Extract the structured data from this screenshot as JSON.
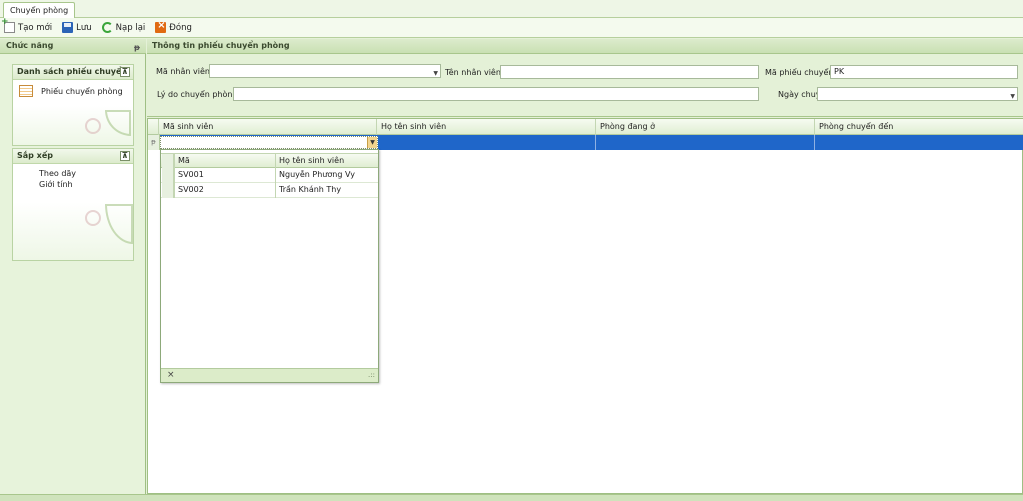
{
  "tab": {
    "label": "Chuyển phòng"
  },
  "toolbar": {
    "new_label": "Tạo mới",
    "save_label": "Lưu",
    "reload_label": "Nạp lại",
    "close_label": "Đóng"
  },
  "left_panel": {
    "title": "Chức năng",
    "pin": "ᵽ",
    "group1": {
      "title": "Danh sách phiếu chuyển",
      "toggle": "⊼",
      "items": [
        "Phiếu chuyển phòng"
      ]
    },
    "group2": {
      "title": "Sắp xếp",
      "toggle": "⊼",
      "items": [
        "Theo dãy",
        "Giới tính"
      ]
    }
  },
  "info_panel": {
    "title": "Thông tin phiếu chuyển phòng",
    "ma_nhan_vien_label": "Mã nhân viên:",
    "ma_nhan_vien_value": "",
    "ten_nhan_vien_label": "Tên nhân viên:",
    "ten_nhan_vien_value": "",
    "ma_phieu_label": "Mã phiếu chuyển:",
    "ma_phieu_value": "PK",
    "ly_do_label": "Lý do chuyển phòng:",
    "ly_do_value": "",
    "ngay_label": "Ngày chuyển:",
    "ngay_value": ""
  },
  "grid": {
    "columns": [
      "Mã sinh viên",
      "Họ tên sinh viên",
      "Phòng đang ở",
      "Phòng chuyển đến"
    ],
    "row_indicator": "ᵽ"
  },
  "popup": {
    "columns": [
      "Mã",
      "Họ tên sinh viên"
    ],
    "rows": [
      {
        "ma": "SV001",
        "ten": "Nguyễn Phương Vy"
      },
      {
        "ma": "SV002",
        "ten": "Trần Khánh Thy"
      }
    ],
    "close": "×",
    "grip": ".::"
  },
  "colors": {
    "accent": "#1f66c9",
    "panel": "#e4f1d7",
    "header": "#c9e0b3"
  }
}
